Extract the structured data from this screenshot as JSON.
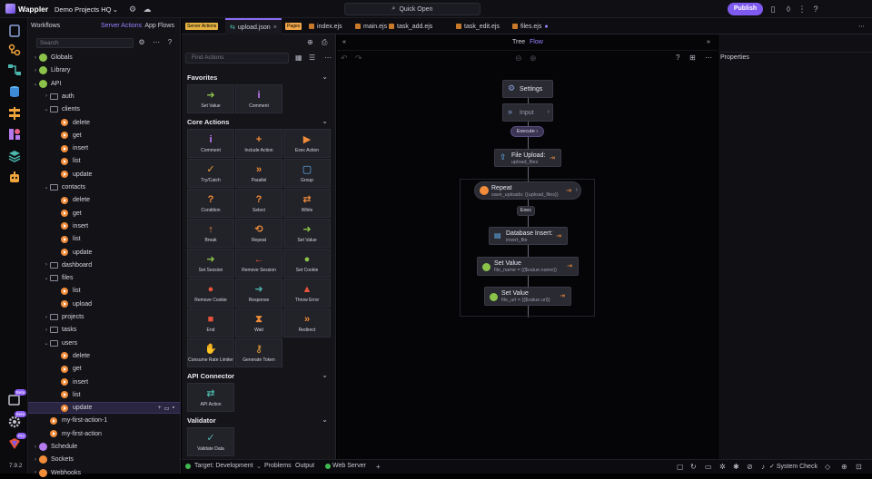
{
  "app": {
    "name": "Wappler",
    "project": "Demo Projects HQ",
    "quick_open": "Quick Open",
    "publish": "Publish",
    "version": "7.9.2"
  },
  "activity": {
    "badges": {
      "extensions": "Beta",
      "settings": "Beta",
      "pro": "Pro"
    }
  },
  "sidebar": {
    "tabs": {
      "workflows": "Workflows",
      "server_actions": "Server Actions",
      "app_flows": "App Flows"
    },
    "search_placeholder": "Search",
    "tree": [
      {
        "label": "Globals",
        "type": "globals",
        "indent": 0
      },
      {
        "label": "Library",
        "type": "library",
        "indent": 0
      },
      {
        "label": "API",
        "type": "api",
        "indent": 0
      },
      {
        "label": "auth",
        "type": "folder",
        "indent": 1
      },
      {
        "label": "clients",
        "type": "folder-open",
        "indent": 1
      },
      {
        "label": "delete",
        "type": "action",
        "indent": 2
      },
      {
        "label": "get",
        "type": "action",
        "indent": 2
      },
      {
        "label": "insert",
        "type": "action",
        "indent": 2
      },
      {
        "label": "list",
        "type": "action",
        "indent": 2
      },
      {
        "label": "update",
        "type": "action",
        "indent": 2
      },
      {
        "label": "contacts",
        "type": "folder-open",
        "indent": 1
      },
      {
        "label": "delete",
        "type": "action",
        "indent": 2
      },
      {
        "label": "get",
        "type": "action",
        "indent": 2
      },
      {
        "label": "insert",
        "type": "action",
        "indent": 2
      },
      {
        "label": "list",
        "type": "action",
        "indent": 2
      },
      {
        "label": "update",
        "type": "action",
        "indent": 2
      },
      {
        "label": "dashboard",
        "type": "folder",
        "indent": 1
      },
      {
        "label": "files",
        "type": "folder-open",
        "indent": 1
      },
      {
        "label": "list",
        "type": "action",
        "indent": 2
      },
      {
        "label": "upload",
        "type": "action",
        "indent": 2
      },
      {
        "label": "projects",
        "type": "folder",
        "indent": 1
      },
      {
        "label": "tasks",
        "type": "folder",
        "indent": 1
      },
      {
        "label": "users",
        "type": "folder-open",
        "indent": 1
      },
      {
        "label": "delete",
        "type": "action",
        "indent": 2
      },
      {
        "label": "get",
        "type": "action",
        "indent": 2
      },
      {
        "label": "insert",
        "type": "action",
        "indent": 2
      },
      {
        "label": "list",
        "type": "action",
        "indent": 2
      },
      {
        "label": "update",
        "type": "action",
        "indent": 2,
        "selected": true
      },
      {
        "label": "my-first-action-1",
        "type": "action",
        "indent": 1
      },
      {
        "label": "my-first-action",
        "type": "action",
        "indent": 1
      },
      {
        "label": "Schedule",
        "type": "schedule",
        "indent": 0
      },
      {
        "label": "Sockets",
        "type": "sockets",
        "indent": 0
      },
      {
        "label": "Webhooks",
        "type": "webhooks",
        "indent": 0
      }
    ]
  },
  "editor_tabs": [
    {
      "label": "Server Actions",
      "badge": true
    },
    {
      "label": "upload.json",
      "active": true
    },
    {
      "label": "Pages",
      "badge": true
    },
    {
      "label": "index.ejs"
    },
    {
      "label": "main.ejs"
    },
    {
      "label": "task_add.ejs"
    },
    {
      "label": "task_edit.ejs"
    },
    {
      "label": "files.ejs"
    }
  ],
  "toolbox": {
    "filter_placeholder": "Find Actions",
    "sections": [
      {
        "title": "Favorites",
        "items": [
          {
            "label": "Set Value",
            "icon": "arrow-right-icon",
            "color": "#8bc34a"
          },
          {
            "label": "Comment",
            "icon": "info-icon",
            "color": "#c77dff"
          }
        ]
      },
      {
        "title": "Core Actions",
        "items": [
          {
            "label": "Comment",
            "icon": "info-icon",
            "color": "#c77dff"
          },
          {
            "label": "Include Action",
            "icon": "plus-icon",
            "color": "#f08c3a"
          },
          {
            "label": "Exec Action",
            "icon": "play-icon",
            "color": "#f08c3a"
          },
          {
            "label": "Try/Catch",
            "icon": "check-icon",
            "color": "#f0a43a"
          },
          {
            "label": "Parallel",
            "icon": "chevrons-right-icon",
            "color": "#f08c3a"
          },
          {
            "label": "Group",
            "icon": "group-icon",
            "color": "#64b5f6"
          },
          {
            "label": "Condition",
            "icon": "question-icon",
            "color": "#f08c3a"
          },
          {
            "label": "Select",
            "icon": "question-icon",
            "color": "#f08c3a"
          },
          {
            "label": "While",
            "icon": "loop-icon",
            "color": "#f08c3a"
          },
          {
            "label": "Break",
            "icon": "arrow-up-icon",
            "color": "#f08c3a"
          },
          {
            "label": "Repeat",
            "icon": "repeat-icon",
            "color": "#f08c3a"
          },
          {
            "label": "Set Value",
            "icon": "arrow-right-icon",
            "color": "#8bc34a"
          },
          {
            "label": "Set Session",
            "icon": "arrow-right-icon",
            "color": "#8bc34a"
          },
          {
            "label": "Remove Session",
            "icon": "arrow-left-icon",
            "color": "#e5533a"
          },
          {
            "label": "Set Cookie",
            "icon": "cookie-icon",
            "color": "#8bc34a"
          },
          {
            "label": "Remove Cookie",
            "icon": "cookie-icon",
            "color": "#e5533a"
          },
          {
            "label": "Response",
            "icon": "arrow-right-icon",
            "color": "#4db6ac"
          },
          {
            "label": "Throw Error",
            "icon": "warning-icon",
            "color": "#e5533a"
          },
          {
            "label": "End",
            "icon": "stop-icon",
            "color": "#e5533a"
          },
          {
            "label": "Wait",
            "icon": "hourglass-icon",
            "color": "#f08c3a"
          },
          {
            "label": "Redirect",
            "icon": "chevrons-right-icon",
            "color": "#f08c3a"
          },
          {
            "label": "Consume Rate Limiter",
            "icon": "hand-icon",
            "color": "#f0a43a"
          },
          {
            "label": "Generate Token",
            "icon": "key-icon",
            "color": "#f0a43a"
          }
        ]
      },
      {
        "title": "API Connector",
        "items": [
          {
            "label": "API Action",
            "icon": "exchange-icon",
            "color": "#4db6ac"
          }
        ]
      },
      {
        "title": "Validator",
        "items": [
          {
            "label": "Validate Data",
            "icon": "check-icon",
            "color": "#4db6ac"
          }
        ]
      }
    ]
  },
  "canvas": {
    "tree_label": "Tree",
    "flow_label": "Flow",
    "nodes": {
      "settings": {
        "title": "Settings"
      },
      "input": {
        "title": "Input"
      },
      "execute": {
        "title": "Execute"
      },
      "file_upload": {
        "title": "File Upload:",
        "sub": "upload_files"
      },
      "repeat": {
        "title": "Repeat",
        "sub": "save_uploads: {{upload_files}}"
      },
      "exec": {
        "title": "Exec"
      },
      "db_insert": {
        "title": "Database Insert:",
        "sub": "insert_file"
      },
      "set_value_1": {
        "title": "Set Value",
        "sub": "file_name = {{$value.name}}"
      },
      "set_value_2": {
        "title": "Set Value",
        "sub": "file_url = {{$value.url}}"
      }
    }
  },
  "properties": {
    "title": "Properties"
  },
  "status": {
    "target": "Target: Development",
    "problems": "Problems",
    "output": "Output",
    "web_server": "Web Server",
    "system_check": "System Check"
  }
}
